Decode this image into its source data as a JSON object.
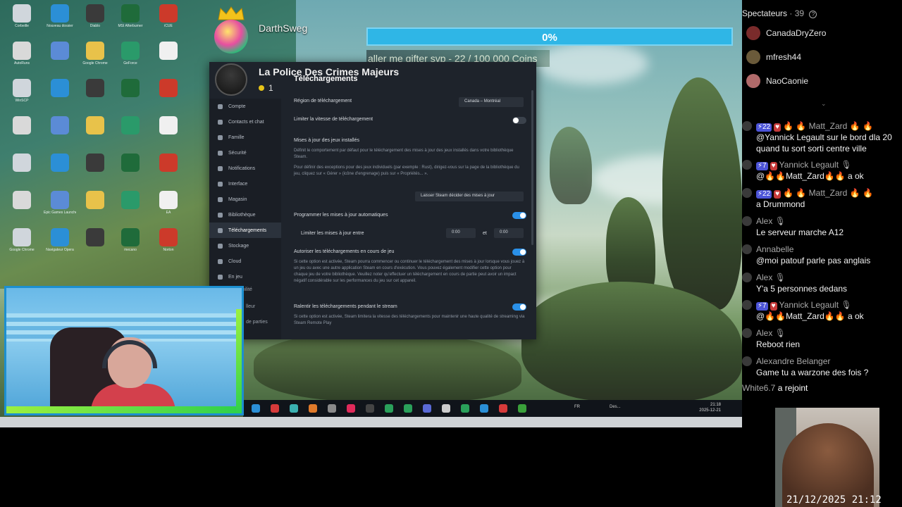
{
  "stream": {
    "donation": {
      "username": "DarthSweg"
    },
    "goal": {
      "percent_label": "0%",
      "progress": 0,
      "text": "aller me gifter svp - 22 / 100 000 Coins"
    },
    "steam": {
      "group_name": "La Police Des Crimes Majeurs",
      "group_count": "1",
      "panel_title": "Téléchargements",
      "sidebar": [
        "Compte",
        "Contacts et chat",
        "Famille",
        "Sécurité",
        "Notifications",
        "Interface",
        "Magasin",
        "Bibliothèque",
        "Téléchargements",
        "Stockage",
        "Cloud",
        "En jeu"
      ],
      "region_label": "Région de téléchargement",
      "region_value": "Canada – Montréal",
      "limit_speed_label": "Limiter la vitesse de téléchargement",
      "updates_heading": "Mises à jour des jeux installés",
      "updates_desc": "Définit le comportement par défaut pour le téléchargement des mises à jour des jeux installés dans votre bibliothèque Steam.",
      "updates_desc2": "Pour définir des exceptions pour des jeux individuels (par exemple : Rust), dirigez-vous sur la page de la bibliothèque du jeu, cliquez sur « Gérer » (icône d'engrenage) puis sur « Propriétés... ».",
      "updates_select": "Laisser Steam décider des mises à jour",
      "schedule_label": "Programmer les mises à jour automatiques",
      "limit_between_label": "Limiter les mises à jour entre",
      "time_from": "0:00",
      "time_et": "et",
      "time_to": "0:00",
      "allow_ingame_label": "Autoriser les téléchargements en cours de jeu",
      "allow_ingame_desc": "Si cette option est activée, Steam pourra commencer ou continuer le téléchargement des mises à jour lorsque vous jouez à un jeu ou avec une autre application Steam en cours d'exécution. Vous pouvez également modifier cette option pour chaque jeu de votre bibliothèque. Veuillez noter qu'effectuer un téléchargement en cours de partie peut avoir un impact négatif considérable sur les performances du jeu sur cet appareil.",
      "throttle_stream_label": "Ralentir les téléchargements pendant le stream",
      "throttle_stream_desc": "Si cette option est activée, Steam limitera la vitesse des téléchargements pour maintenir une haute qualité de streaming via Steam Remote Play",
      "hidden_sidebar_fragments": [
        "ibilité",
        "lleur",
        "de parties"
      ]
    },
    "desktop_icons": [
      "Corbeille",
      "Nouveau dossier",
      "Diablo",
      "MSI Afterburner",
      "iCUE",
      "AutoRuns",
      "",
      "Google Chrome",
      "GeForce",
      "",
      "WinSCP",
      "",
      "",
      "",
      "",
      "",
      "",
      "",
      "",
      "",
      "",
      "",
      "",
      "",
      "",
      "",
      "Epic Games Launcher",
      "",
      "",
      "EA",
      "Google Chrome",
      "Navigateur Opera",
      "",
      "mecano",
      "Norton"
    ],
    "taskbar": {
      "lang": "FR",
      "desk_label": "Des...",
      "time": "21:18",
      "date": "2025-12-21"
    }
  },
  "chat": {
    "viewers_label": "Spectateurs",
    "viewers_count": "· 39",
    "viewers": [
      {
        "name": "CanadaDryZero",
        "color": "#7a2b2b"
      },
      {
        "name": "mfresh44",
        "color": "#6a5a3a"
      },
      {
        "name": "NaoCaonie",
        "color": "#b06a6a"
      }
    ],
    "messages": [
      {
        "badges": [
          "⚡22",
          "♥"
        ],
        "user": "🔥 🔥 Matt_Zard 🔥 🔥",
        "text": "@Yannick Legault sur le bord dla 20 quand tu sort sorti centre ville",
        "user_color": "#a8a8a8"
      },
      {
        "badges": [
          "⚡7",
          "♥"
        ],
        "user": "Yannick Legault 🎙",
        "text": "@🔥🔥Matt_Zard🔥🔥 a ok",
        "user_color": "#a8a8a8"
      },
      {
        "badges": [
          "⚡22",
          "♥"
        ],
        "user": "🔥 🔥 Matt_Zard 🔥 🔥",
        "text": "a Drummond",
        "user_color": "#a8a8a8"
      },
      {
        "badges": [],
        "user": "Alex 🎙",
        "text": "Le serveur marche A12",
        "user_color": "#a8a8a8"
      },
      {
        "badges": [],
        "user": "Annabelle",
        "text": "@moi patouf parle pas anglais",
        "user_color": "#a8a8a8"
      },
      {
        "badges": [],
        "user": "Alex 🎙",
        "text": "Y'a 5 personnes dedans",
        "user_color": "#a8a8a8"
      },
      {
        "badges": [
          "⚡7",
          "♥"
        ],
        "user": "Yannick Legault 🎙",
        "text": "@🔥🔥Matt_Zard🔥🔥 a ok",
        "user_color": "#a8a8a8"
      },
      {
        "badges": [],
        "user": "Alex 🎙",
        "text": "Reboot rien",
        "user_color": "#a8a8a8"
      },
      {
        "badges": [],
        "user": "Alexandre Belanger",
        "text": "Game tu a warzone des fois ?",
        "user_color": "#a8a8a8"
      }
    ],
    "joined_user": "White6.7",
    "joined_text": "a rejoint"
  },
  "overlay": {
    "timestamp": "21/12/2025 21:12"
  },
  "colors": {
    "goal_bar": "#2fb6e6",
    "steam_toggle": "#2a90e8",
    "neon_green": "#9cf03f",
    "sub_badge": "#4c54d8"
  }
}
